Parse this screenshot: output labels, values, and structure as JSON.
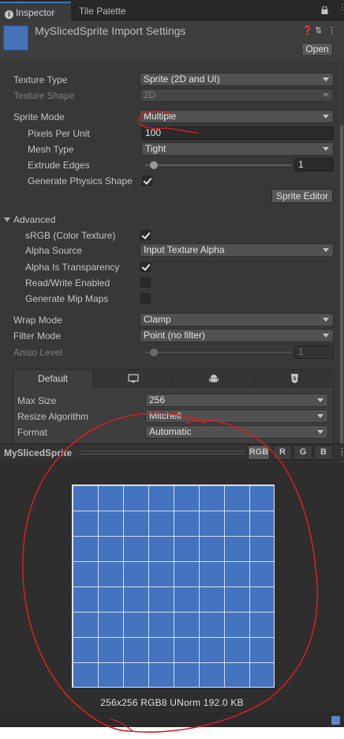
{
  "tabs": [
    {
      "label": "Inspector",
      "active": true
    },
    {
      "label": "Tile Palette",
      "active": false
    }
  ],
  "header": {
    "title": "MySlicedSprite Import Settings",
    "open_label": "Open",
    "thumb_color": "#4772b8"
  },
  "props": {
    "texture_type": {
      "label": "Texture Type",
      "value": "Sprite (2D and UI)"
    },
    "texture_shape": {
      "label": "Texture Shape",
      "value": "2D"
    },
    "sprite_mode": {
      "label": "Sprite Mode",
      "value": "Multiple"
    },
    "pixels_per_unit": {
      "label": "Pixels Per Unit",
      "value": "100"
    },
    "mesh_type": {
      "label": "Mesh Type",
      "value": "Tight"
    },
    "extrude_edges": {
      "label": "Extrude Edges",
      "value": "1",
      "slider_fraction": 0.06
    },
    "generate_physics_shape": {
      "label": "Generate Physics Shape",
      "checked": true
    },
    "sprite_editor_label": "Sprite Editor"
  },
  "advanced": {
    "label": "Advanced",
    "srgb": {
      "label": "sRGB (Color Texture)",
      "checked": true
    },
    "alpha_source": {
      "label": "Alpha Source",
      "value": "Input Texture Alpha"
    },
    "alpha_is_transparency": {
      "label": "Alpha Is Transparency",
      "checked": true
    },
    "read_write": {
      "label": "Read/Write Enabled",
      "checked": false
    },
    "mip_maps": {
      "label": "Generate Mip Maps",
      "checked": false
    }
  },
  "wrap": {
    "wrap_mode": {
      "label": "Wrap Mode",
      "value": "Clamp"
    },
    "filter_mode": {
      "label": "Filter Mode",
      "value": "Point (no filter)"
    },
    "aniso_level": {
      "label": "Aniso Level",
      "value": "1",
      "slider_fraction": 0.06
    }
  },
  "platform": {
    "tabs": [
      "Default",
      "desktop-icon",
      "android-icon",
      "webgl-icon"
    ],
    "max_size": {
      "label": "Max Size",
      "value": "256"
    },
    "resize_algorithm": {
      "label": "Resize Algorithm",
      "value": "Mitchell"
    },
    "format": {
      "label": "Format",
      "value": "Automatic"
    }
  },
  "preview": {
    "title": "MySlicedSprite",
    "channels": [
      "RGB",
      "R",
      "G",
      "B"
    ],
    "info": "256x256  RGB8 UNorm   192.0 KB",
    "sprite_color": "#4473bf",
    "grid_cells": 8
  },
  "annotation_color": "#d42020"
}
